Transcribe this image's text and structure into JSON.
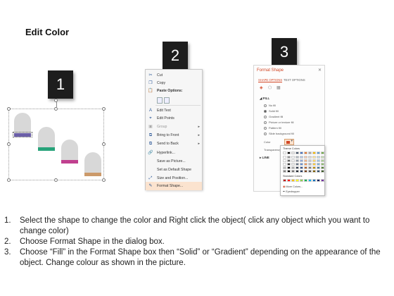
{
  "title": "Edit Color",
  "badges": [
    "1",
    "2",
    "3"
  ],
  "shapes": {
    "colors": [
      "#6b5fa8",
      "#27a37a",
      "#c0408f",
      "#cc9a6a"
    ]
  },
  "context_menu": {
    "items": [
      {
        "label": "Cut",
        "icon": "scissors-icon"
      },
      {
        "label": "Copy",
        "icon": "copy-icon"
      },
      {
        "label": "Paste Options:",
        "icon": "paste-icon",
        "header": true
      },
      {
        "label": "Edit Text",
        "icon": "edit-text-icon"
      },
      {
        "label": "Edit Points",
        "icon": "edit-points-icon"
      },
      {
        "label": "Group",
        "icon": "group-icon",
        "submenu": true
      },
      {
        "label": "Bring to Front",
        "icon": "bring-front-icon",
        "submenu": true
      },
      {
        "label": "Send to Back",
        "icon": "send-back-icon",
        "submenu": true
      },
      {
        "label": "Hyperlink...",
        "icon": "hyperlink-icon"
      },
      {
        "label": "Save as Picture...",
        "icon": ""
      },
      {
        "label": "Set as Default Shape",
        "icon": ""
      },
      {
        "label": "Size and Position...",
        "icon": "size-position-icon"
      },
      {
        "label": "Format Shape...",
        "icon": "format-shape-icon",
        "highlighted": true
      }
    ]
  },
  "format_shape": {
    "title": "Format Shape",
    "tabs": [
      "SHAPE OPTIONS",
      "TEXT OPTIONS"
    ],
    "fill_section": "FILL",
    "fill_options": [
      {
        "label": "No fill",
        "selected": false
      },
      {
        "label": "Solid fill",
        "selected": true
      },
      {
        "label": "Gradient fill",
        "selected": false
      },
      {
        "label": "Picture or texture fill",
        "selected": false
      },
      {
        "label": "Pattern fill",
        "selected": false
      },
      {
        "label": "Slide background fill",
        "selected": false
      }
    ],
    "color_label": "Color",
    "transparency_label": "Transparency",
    "line_section": "LINE",
    "accent_color": "#d24726"
  },
  "palette": {
    "theme_label": "Theme Colors",
    "standard_label": "Standard Colors",
    "more_colors": "More Colors...",
    "eyedropper": "Eyedropper",
    "theme_top": [
      "#ffffff",
      "#000000",
      "#e7e6e6",
      "#44546a",
      "#4472c4",
      "#ed7d31",
      "#a5a5a5",
      "#ffc000",
      "#5b9bd5",
      "#70ad47"
    ],
    "standard": [
      "#c00000",
      "#ff0000",
      "#ffc000",
      "#ffff00",
      "#92d050",
      "#00b050",
      "#00b0f0",
      "#0070c0",
      "#002060",
      "#7030a0"
    ]
  },
  "instructions": [
    {
      "num": "1.",
      "text": "Select the shape to change the color and Right click the object( click any object which you want to change color)"
    },
    {
      "num": "2.",
      "text": "Choose Format Shape in the dialog box."
    },
    {
      "num": "3.",
      "text": "Choose “Fill” in the Format Shape box then “Solid” or “Gradient” depending on the appearance of the object. Change colour as shown in the picture."
    }
  ]
}
